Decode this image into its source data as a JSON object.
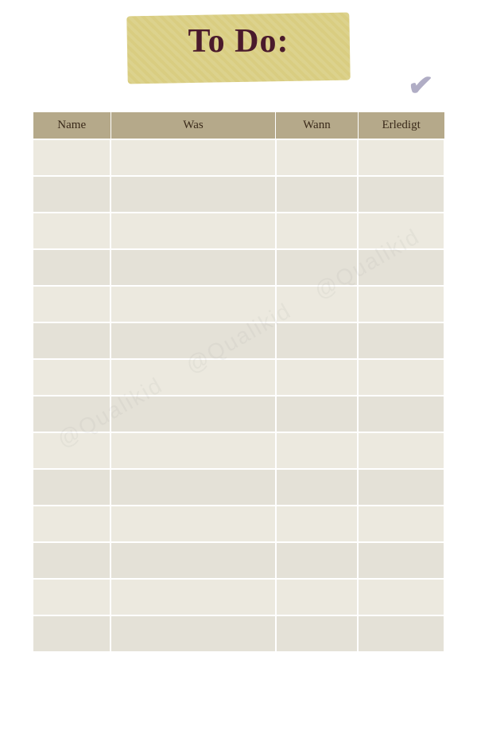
{
  "header": {
    "title": "To Do:",
    "checkmark": "✔"
  },
  "watermark": "@Qualikid",
  "table": {
    "columns": [
      {
        "id": "name",
        "label": "Name"
      },
      {
        "id": "was",
        "label": "Was"
      },
      {
        "id": "wann",
        "label": "Wann"
      },
      {
        "id": "erledigt",
        "label": "Erledigt"
      }
    ],
    "row_count": 14
  }
}
